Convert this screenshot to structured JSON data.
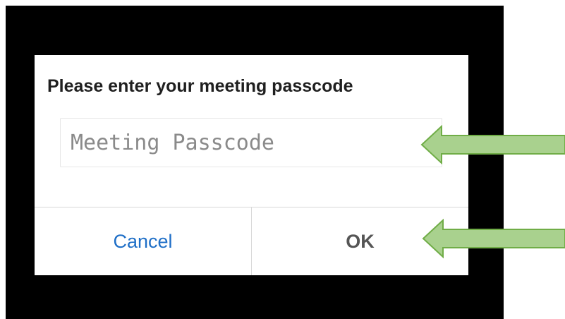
{
  "dialog": {
    "title": "Please enter your meeting passcode",
    "passcode_placeholder": "Meeting Passcode",
    "passcode_value": "",
    "cancel_label": "Cancel",
    "ok_label": "OK"
  },
  "annotations": {
    "arrow_color": "#a9d18e",
    "arrow_stroke": "#70ad47"
  },
  "colors": {
    "backdrop": "#000000",
    "dialog_bg": "#ffffff",
    "cancel_text": "#1f6fc7",
    "ok_text": "#555555"
  }
}
